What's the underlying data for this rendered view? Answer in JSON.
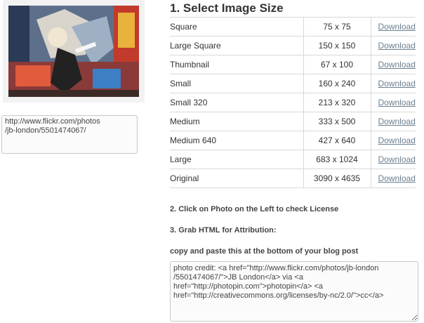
{
  "photo": {
    "alt": "Graffiti wall photo thumbnail"
  },
  "url_box": {
    "value": "http://www.flickr.com/photos\n/jb-london/5501474067/"
  },
  "heading": "1. Select Image Size",
  "sizes": [
    {
      "name": "Square",
      "dims": "75 x 75",
      "link": "Download"
    },
    {
      "name": "Large Square",
      "dims": "150 x 150",
      "link": "Download"
    },
    {
      "name": "Thumbnail",
      "dims": "67 x 100",
      "link": "Download"
    },
    {
      "name": "Small",
      "dims": "160 x 240",
      "link": "Download"
    },
    {
      "name": "Small 320",
      "dims": "213 x 320",
      "link": "Download"
    },
    {
      "name": "Medium",
      "dims": "333 x 500",
      "link": "Download"
    },
    {
      "name": "Medium 640",
      "dims": "427 x 640",
      "link": "Download"
    },
    {
      "name": "Large",
      "dims": "683 x 1024",
      "link": "Download"
    },
    {
      "name": "Original",
      "dims": "3090 x 4635",
      "link": "Download"
    }
  ],
  "step2": "2. Click on Photo on the Left to check License",
  "step3": "3. Grab HTML for Attribution:",
  "copy_label": "copy and paste this at the bottom of your blog post",
  "attribution": {
    "value": "photo credit: <a href=\"http://www.flickr.com/photos/jb-london\n/5501474067/\">JB London</a> via <a\nhref=\"http://photopin.com\">photopin</a> <a\nhref=\"http://creativecommons.org/licenses/by-nc/2.0/\">cc</a>"
  },
  "colors": {
    "link": "#6b7f8f",
    "border": "#d8d8d8"
  }
}
